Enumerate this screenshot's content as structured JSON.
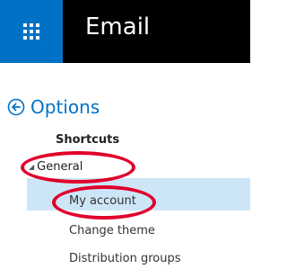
{
  "topbar": {
    "app_title": "Email",
    "accent_color": "#0072c6",
    "launcher_icon": "waffle-grid-icon"
  },
  "nav": {
    "options_label": "Options",
    "back_icon": "back-arrow-circle-icon",
    "items": [
      {
        "label": "Shortcuts"
      },
      {
        "label": "General",
        "expanded": true
      },
      {
        "label": "My account",
        "selected": true
      },
      {
        "label": "Change theme"
      },
      {
        "label": "Distribution groups"
      }
    ]
  },
  "annotations": {
    "color": "#e0002a",
    "highlighted": [
      "General",
      "My account"
    ]
  }
}
